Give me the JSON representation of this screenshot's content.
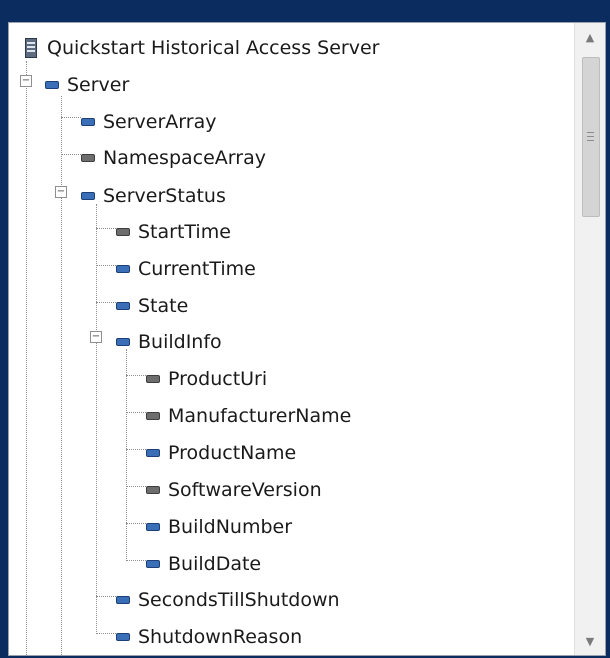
{
  "tree": {
    "root": {
      "label": "Quickstart Historical Access Server",
      "icon": "server-icon"
    },
    "nodes": [
      {
        "label": "Server",
        "icon": "blue-node-icon",
        "expanded": true
      },
      {
        "label": "ServerArray",
        "icon": "blue-node-icon"
      },
      {
        "label": "NamespaceArray",
        "icon": "gray-node-icon"
      },
      {
        "label": "ServerStatus",
        "icon": "blue-node-icon",
        "expanded": true
      },
      {
        "label": "StartTime",
        "icon": "gray-node-icon"
      },
      {
        "label": "CurrentTime",
        "icon": "blue-node-icon"
      },
      {
        "label": "State",
        "icon": "blue-node-icon"
      },
      {
        "label": "BuildInfo",
        "icon": "blue-node-icon",
        "expanded": true
      },
      {
        "label": "ProductUri",
        "icon": "gray-node-icon"
      },
      {
        "label": "ManufacturerName",
        "icon": "gray-node-icon"
      },
      {
        "label": "ProductName",
        "icon": "blue-node-icon"
      },
      {
        "label": "SoftwareVersion",
        "icon": "gray-node-icon"
      },
      {
        "label": "BuildNumber",
        "icon": "blue-node-icon"
      },
      {
        "label": "BuildDate",
        "icon": "blue-node-icon"
      },
      {
        "label": "SecondsTillShutdown",
        "icon": "blue-node-icon"
      },
      {
        "label": "ShutdownReason",
        "icon": "blue-node-icon"
      }
    ]
  },
  "scrollbar": {
    "up_icon": "▲",
    "down_icon": "▼"
  },
  "colors": {
    "node_blue": "#3a6fb7",
    "node_gray": "#6d6d6d",
    "background": "#0b2c5e"
  }
}
